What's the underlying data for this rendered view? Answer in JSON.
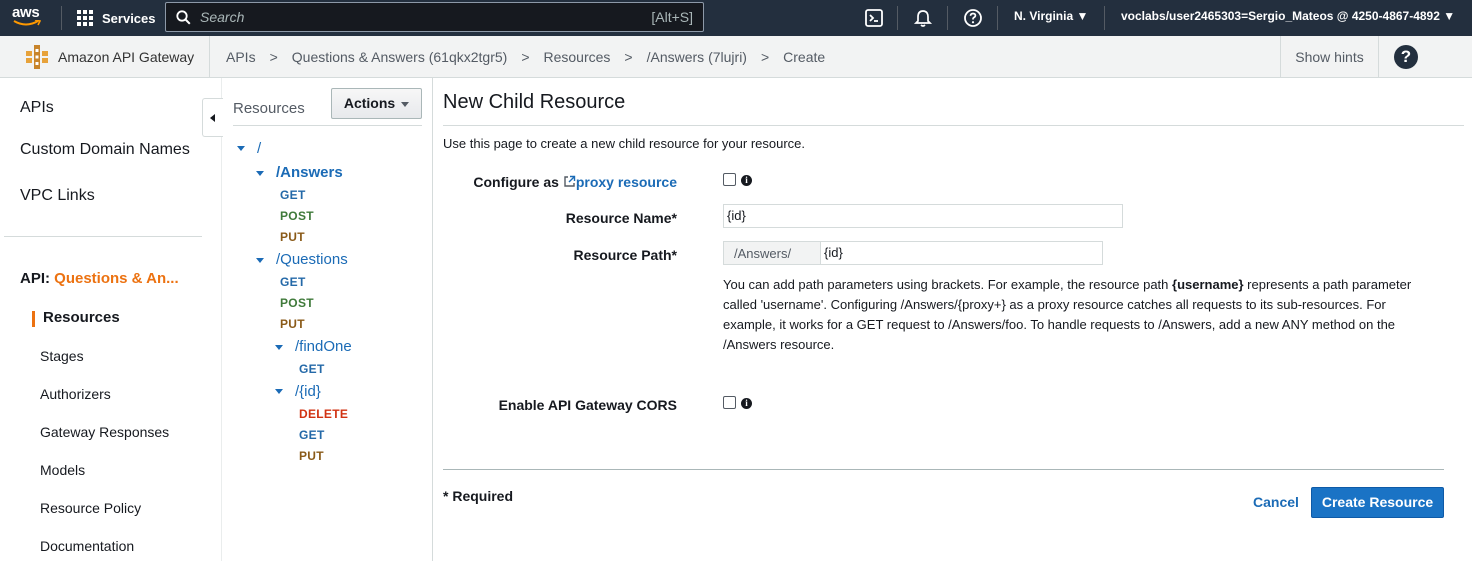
{
  "topnav": {
    "logo_text": "aws",
    "services_label": "Services",
    "search_placeholder": "Search",
    "search_shortcut": "[Alt+S]",
    "region": "N. Virginia",
    "account": "voclabs/user2465303=Sergio_Mateos @ 4250-4867-4892"
  },
  "subnav": {
    "service_name": "Amazon API Gateway",
    "breadcrumbs": [
      "APIs",
      "Questions & Answers (61qkx2tgr5)",
      "Resources",
      "/Answers (7lujri)",
      "Create"
    ],
    "show_hints": "Show hints"
  },
  "leftnav": {
    "top_items": [
      "APIs",
      "Custom Domain Names",
      "VPC Links"
    ],
    "api_prefix": "API:",
    "api_name": "Questions & An...",
    "sub_items": [
      "Resources",
      "Stages",
      "Authorizers",
      "Gateway Responses",
      "Models",
      "Resource Policy",
      "Documentation"
    ]
  },
  "tree": {
    "header": "Resources",
    "actions_label": "Actions",
    "root": "/",
    "answers": "/Answers",
    "questions": "/Questions",
    "findone": "/findOne",
    "id": "/{id}",
    "methods": {
      "get": "GET",
      "post": "POST",
      "put": "PUT",
      "delete": "DELETE"
    }
  },
  "form": {
    "title": "New Child Resource",
    "intro": "Use this page to create a new child resource for your resource.",
    "proxy_label_prefix": "Configure as",
    "proxy_link": "proxy resource",
    "name_label": "Resource Name*",
    "name_value": "{id}",
    "path_label": "Resource Path*",
    "path_prefix": "/Answers/",
    "path_value": "{id}",
    "help_1": "You can add path parameters using brackets. For example, the resource path ",
    "help_bold": "{username}",
    "help_2": " represents a path parameter called 'username'. Configuring /Answers/{proxy+} as a proxy resource catches all requests to its sub-resources. For example, it works for a GET request to /Answers/foo. To handle requests to /Answers, add a new ANY method on the /Answers resource.",
    "cors_label": "Enable API Gateway CORS",
    "required_note": "* Required",
    "cancel": "Cancel",
    "create": "Create Resource"
  }
}
